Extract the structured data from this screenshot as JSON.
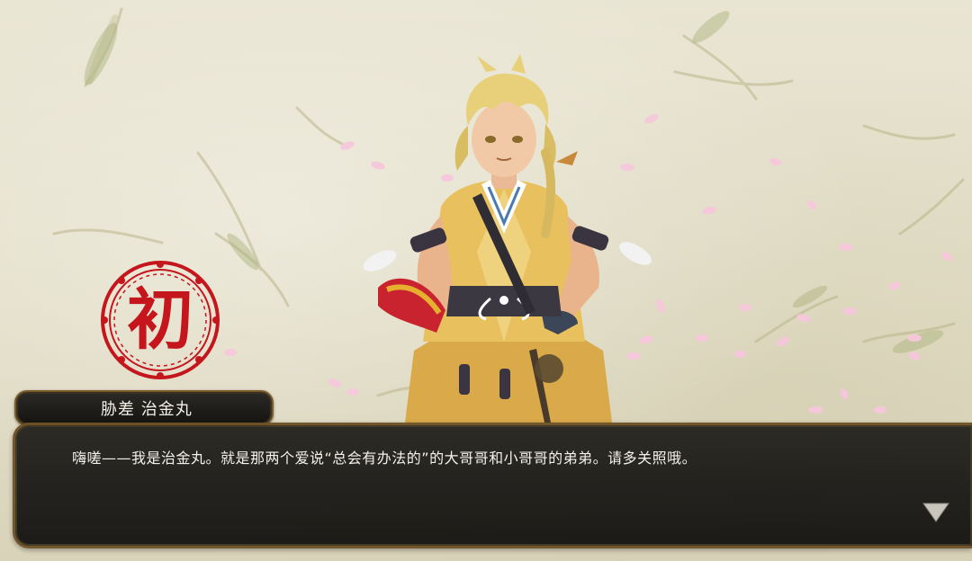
{
  "scene": {
    "character_name": "胁差 治金丸",
    "dialog_line": "嗨嗟——我是治金丸。就是那两个爱说“总会有办法的”的大哥哥和小哥哥的弟弟。请多关照哦。",
    "badge_glyph": "初"
  },
  "icons": {
    "badge": "first-time-seal-icon",
    "advance": "advance-triangle-icon"
  },
  "colors": {
    "badge_red": "#c4161c",
    "frame_gold": "#6e5226",
    "dialog_bg": "#1c1a17",
    "text": "#f4f1e8",
    "robe": "#e8c15e"
  }
}
